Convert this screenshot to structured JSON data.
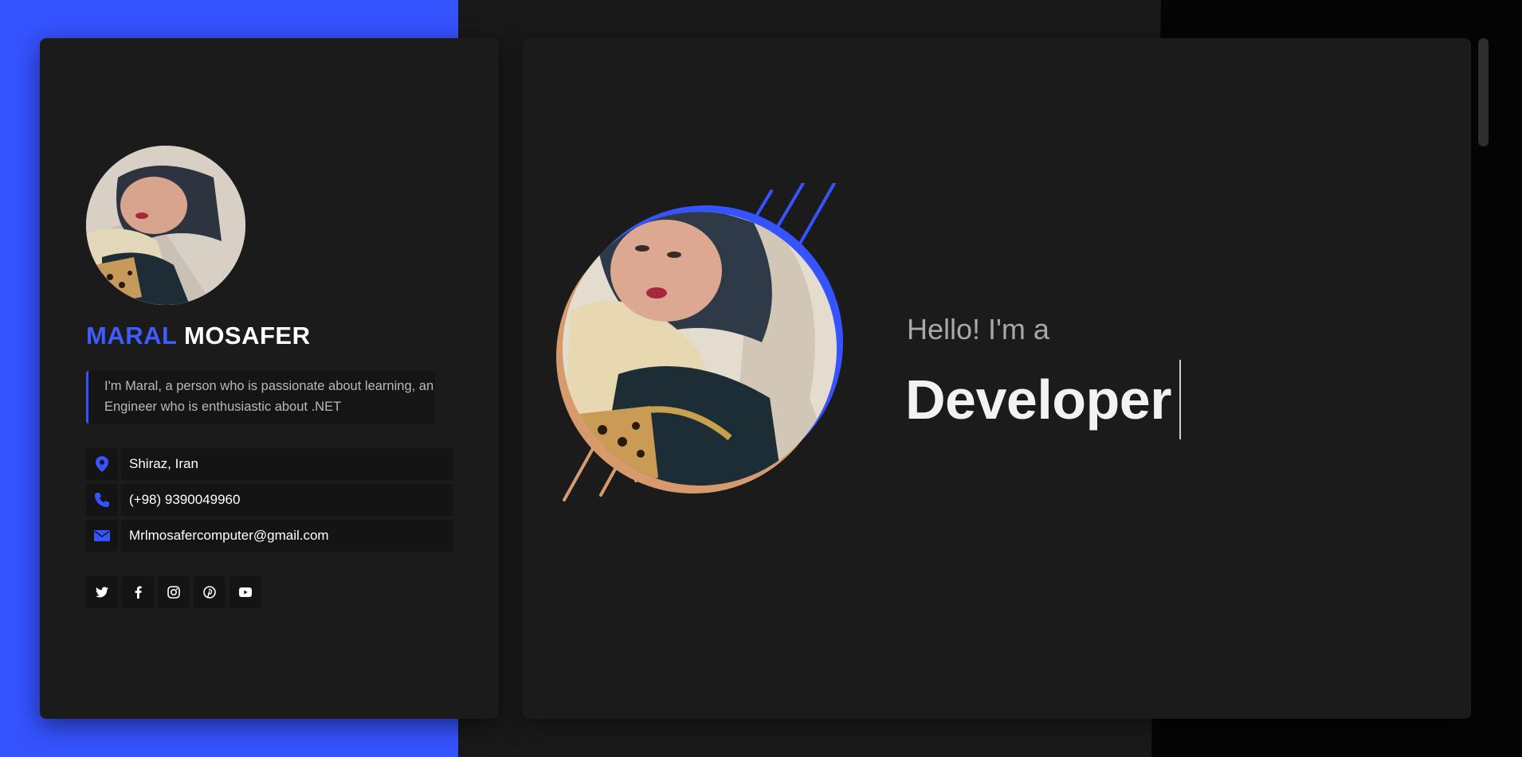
{
  "profile": {
    "first_name": "MARAL",
    "last_name": "MOSAFER",
    "bio": "I'm Maral, a person who is passionate about learning, an Engineer who is enthusiastic about .NET"
  },
  "contacts": [
    {
      "icon": "location-pin-icon",
      "text": "Shiraz, Iran"
    },
    {
      "icon": "phone-icon",
      "text": "(+98) 9390049960"
    },
    {
      "icon": "envelope-icon",
      "text": "Mrlmosafercomputer@gmail.com"
    }
  ],
  "socials": [
    "twitter-icon",
    "facebook-icon",
    "instagram-icon",
    "pinterest-icon",
    "youtube-icon"
  ],
  "hero": {
    "greeting": "Hello! I'm a",
    "role": "Developer"
  },
  "colors": {
    "accent": "#3553ff",
    "accent_secondary": "#d69a6c",
    "card": "#1b1b1b",
    "page_dark": "#050505"
  }
}
